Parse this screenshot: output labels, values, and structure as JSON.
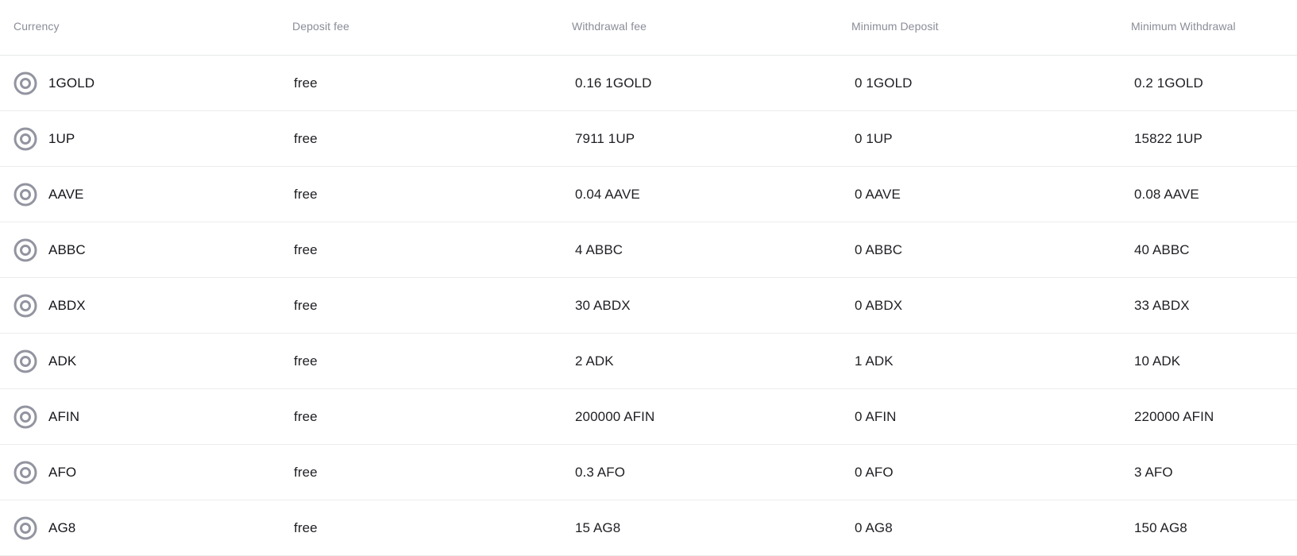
{
  "table": {
    "headers": {
      "currency": "Currency",
      "deposit_fee": "Deposit fee",
      "withdrawal_fee": "Withdrawal fee",
      "min_deposit": "Minimum Deposit",
      "min_withdrawal": "Minimum Withdrawal"
    },
    "icon": "target-circle-icon",
    "icon_color": "#9294a0",
    "rows": [
      {
        "currency": "1GOLD",
        "deposit_fee": "free",
        "withdrawal_fee": "0.16 1GOLD",
        "min_deposit": "0 1GOLD",
        "min_withdrawal": "0.2 1GOLD"
      },
      {
        "currency": "1UP",
        "deposit_fee": "free",
        "withdrawal_fee": "7911 1UP",
        "min_deposit": "0 1UP",
        "min_withdrawal": "15822 1UP"
      },
      {
        "currency": "AAVE",
        "deposit_fee": "free",
        "withdrawal_fee": "0.04 AAVE",
        "min_deposit": "0 AAVE",
        "min_withdrawal": "0.08 AAVE"
      },
      {
        "currency": "ABBC",
        "deposit_fee": "free",
        "withdrawal_fee": "4 ABBC",
        "min_deposit": "0 ABBC",
        "min_withdrawal": "40 ABBC"
      },
      {
        "currency": "ABDX",
        "deposit_fee": "free",
        "withdrawal_fee": "30 ABDX",
        "min_deposit": "0 ABDX",
        "min_withdrawal": "33 ABDX"
      },
      {
        "currency": "ADK",
        "deposit_fee": "free",
        "withdrawal_fee": "2 ADK",
        "min_deposit": "1 ADK",
        "min_withdrawal": "10 ADK"
      },
      {
        "currency": "AFIN",
        "deposit_fee": "free",
        "withdrawal_fee": "200000 AFIN",
        "min_deposit": "0 AFIN",
        "min_withdrawal": "220000 AFIN"
      },
      {
        "currency": "AFO",
        "deposit_fee": "free",
        "withdrawal_fee": "0.3 AFO",
        "min_deposit": "0 AFO",
        "min_withdrawal": "3 AFO"
      },
      {
        "currency": "AG8",
        "deposit_fee": "free",
        "withdrawal_fee": "15 AG8",
        "min_deposit": "0 AG8",
        "min_withdrawal": "150 AG8"
      }
    ]
  }
}
